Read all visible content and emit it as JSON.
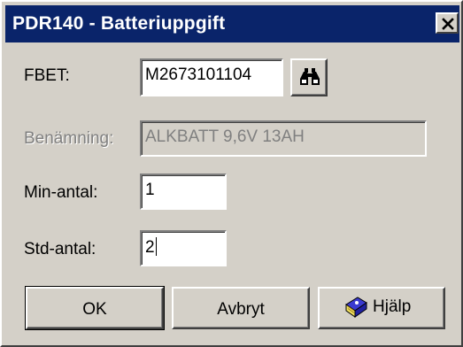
{
  "window": {
    "title": "PDR140 - Batteriuppgift"
  },
  "icons": {
    "close": "close-icon",
    "search": "binoculars-icon",
    "help": "help-book-icon"
  },
  "form": {
    "fbet_label": "FBET:",
    "fbet_value": "M2673101104",
    "benamning_label": "Benämning:",
    "benamning_value": "ALKBATT 9,6V 13AH",
    "min_label": "Min-antal:",
    "min_value": "1",
    "std_label": "Std-antal:",
    "std_value": "2"
  },
  "buttons": {
    "ok": "OK",
    "cancel": "Avbryt",
    "help": "Hjälp"
  },
  "colors": {
    "titlebar": "#0a246a",
    "face": "#d4d0c8"
  }
}
